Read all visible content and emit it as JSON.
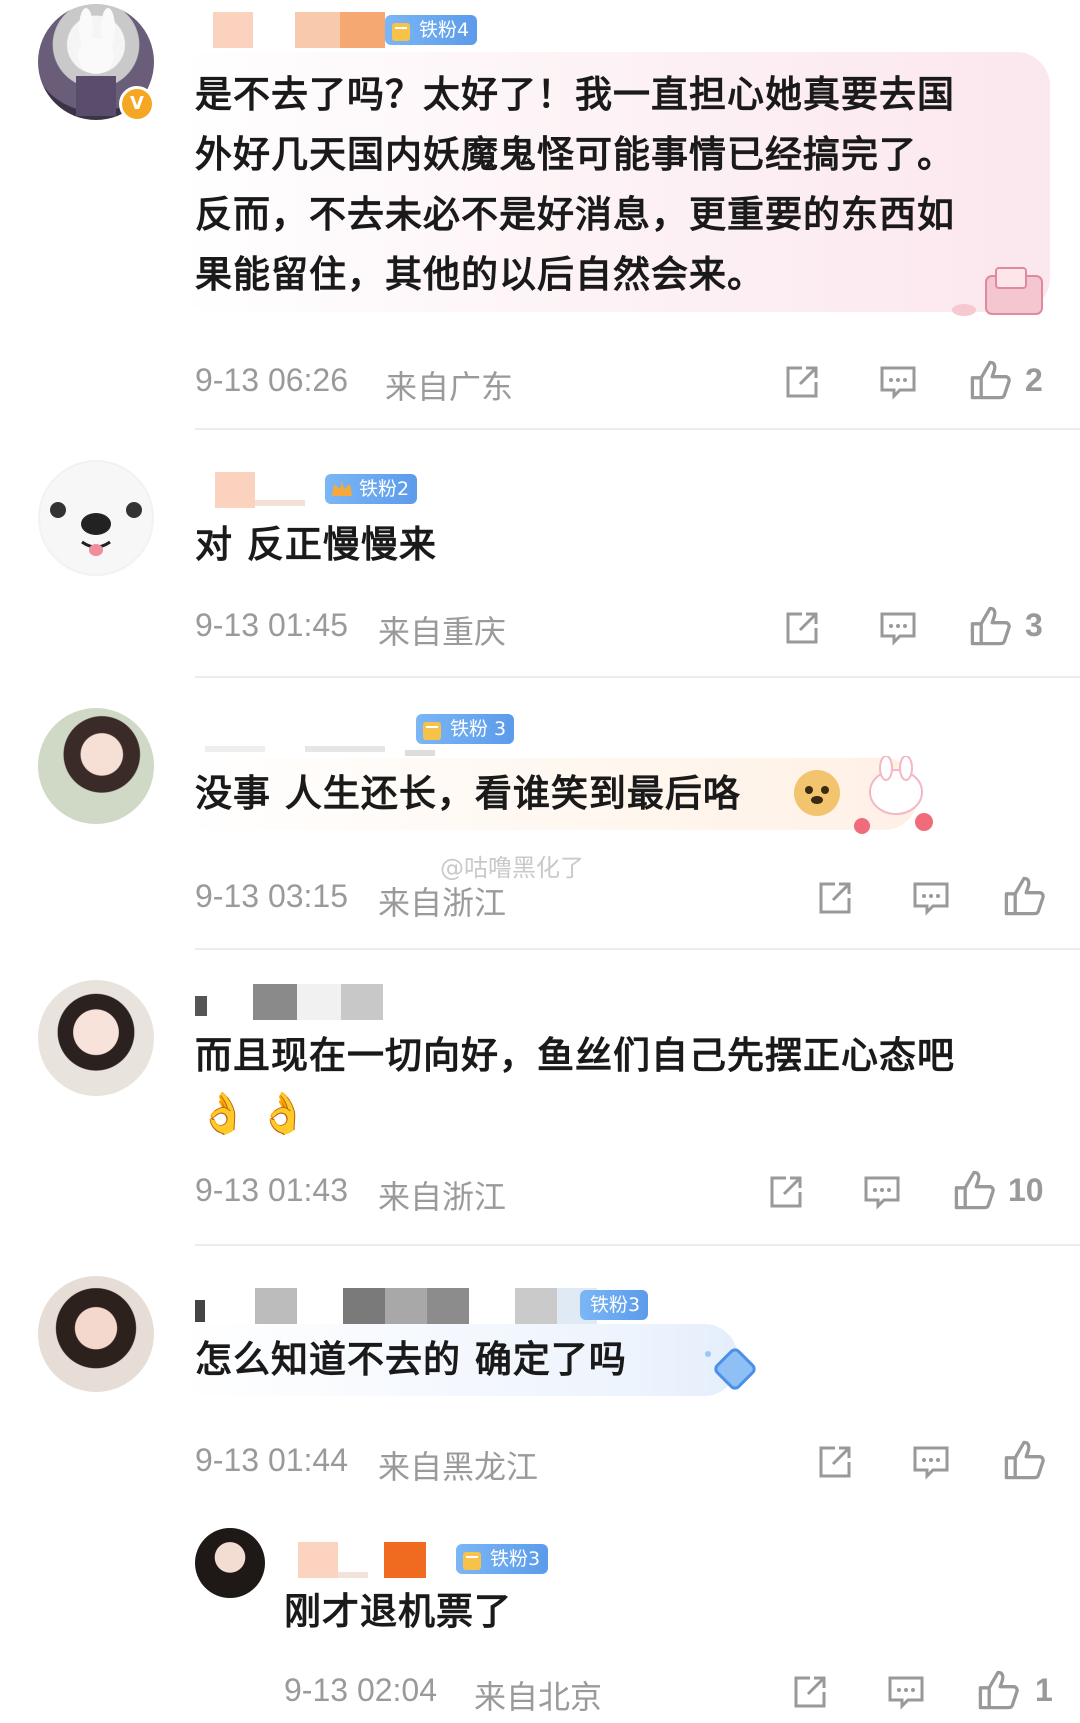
{
  "watermark": "@咕噜黑化了",
  "comments": [
    {
      "badge": "铁粉4",
      "verified": "V",
      "text_lines": [
        "是不去了吗？太好了！我一直担心她真要去国",
        "外好几天国内妖魔鬼怪可能事情已经搞完了。",
        "反而，不去未必不是好消息，更重要的东西如",
        "果能留住，其他的以后自然会来。"
      ],
      "time": "9-13 06:26",
      "location": "来自广东",
      "likes": "2"
    },
    {
      "badge": "铁粉2",
      "text_lines": [
        "对 反正慢慢来"
      ],
      "time": "9-13 01:45",
      "location": "来自重庆",
      "likes": "3"
    },
    {
      "badge": "铁粉 3",
      "text_lines": [
        "没事 人生还长，看谁笑到最后咯"
      ],
      "time": "9-13 03:15",
      "location": "来自浙江",
      "likes": ""
    },
    {
      "badge": "",
      "text_lines": [
        "而且现在一切向好，鱼丝们自己先摆正心态吧"
      ],
      "emojis": [
        "👌",
        "👌"
      ],
      "time": "9-13 01:43",
      "location": "来自浙江",
      "likes": "10"
    },
    {
      "badge": "铁粉3",
      "text_lines": [
        "怎么知道不去的 确定了吗"
      ],
      "time": "9-13 01:44",
      "location": "来自黑龙江",
      "likes": ""
    },
    {
      "badge": "铁粉3",
      "text_lines": [
        "刚才退机票了"
      ],
      "time": "9-13 02:04",
      "location": "来自北京",
      "likes": "1"
    }
  ]
}
